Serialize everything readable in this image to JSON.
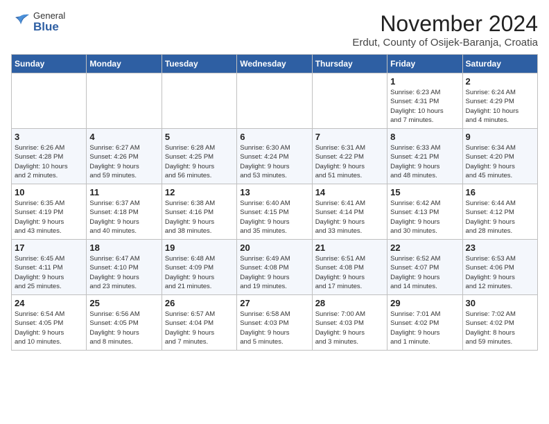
{
  "header": {
    "logo_general": "General",
    "logo_blue": "Blue",
    "main_title": "November 2024",
    "subtitle": "Erdut, County of Osijek-Baranja, Croatia"
  },
  "calendar": {
    "weekdays": [
      "Sunday",
      "Monday",
      "Tuesday",
      "Wednesday",
      "Thursday",
      "Friday",
      "Saturday"
    ],
    "weeks": [
      [
        {
          "day": "",
          "info": ""
        },
        {
          "day": "",
          "info": ""
        },
        {
          "day": "",
          "info": ""
        },
        {
          "day": "",
          "info": ""
        },
        {
          "day": "",
          "info": ""
        },
        {
          "day": "1",
          "info": "Sunrise: 6:23 AM\nSunset: 4:31 PM\nDaylight: 10 hours\nand 7 minutes."
        },
        {
          "day": "2",
          "info": "Sunrise: 6:24 AM\nSunset: 4:29 PM\nDaylight: 10 hours\nand 4 minutes."
        }
      ],
      [
        {
          "day": "3",
          "info": "Sunrise: 6:26 AM\nSunset: 4:28 PM\nDaylight: 10 hours\nand 2 minutes."
        },
        {
          "day": "4",
          "info": "Sunrise: 6:27 AM\nSunset: 4:26 PM\nDaylight: 9 hours\nand 59 minutes."
        },
        {
          "day": "5",
          "info": "Sunrise: 6:28 AM\nSunset: 4:25 PM\nDaylight: 9 hours\nand 56 minutes."
        },
        {
          "day": "6",
          "info": "Sunrise: 6:30 AM\nSunset: 4:24 PM\nDaylight: 9 hours\nand 53 minutes."
        },
        {
          "day": "7",
          "info": "Sunrise: 6:31 AM\nSunset: 4:22 PM\nDaylight: 9 hours\nand 51 minutes."
        },
        {
          "day": "8",
          "info": "Sunrise: 6:33 AM\nSunset: 4:21 PM\nDaylight: 9 hours\nand 48 minutes."
        },
        {
          "day": "9",
          "info": "Sunrise: 6:34 AM\nSunset: 4:20 PM\nDaylight: 9 hours\nand 45 minutes."
        }
      ],
      [
        {
          "day": "10",
          "info": "Sunrise: 6:35 AM\nSunset: 4:19 PM\nDaylight: 9 hours\nand 43 minutes."
        },
        {
          "day": "11",
          "info": "Sunrise: 6:37 AM\nSunset: 4:18 PM\nDaylight: 9 hours\nand 40 minutes."
        },
        {
          "day": "12",
          "info": "Sunrise: 6:38 AM\nSunset: 4:16 PM\nDaylight: 9 hours\nand 38 minutes."
        },
        {
          "day": "13",
          "info": "Sunrise: 6:40 AM\nSunset: 4:15 PM\nDaylight: 9 hours\nand 35 minutes."
        },
        {
          "day": "14",
          "info": "Sunrise: 6:41 AM\nSunset: 4:14 PM\nDaylight: 9 hours\nand 33 minutes."
        },
        {
          "day": "15",
          "info": "Sunrise: 6:42 AM\nSunset: 4:13 PM\nDaylight: 9 hours\nand 30 minutes."
        },
        {
          "day": "16",
          "info": "Sunrise: 6:44 AM\nSunset: 4:12 PM\nDaylight: 9 hours\nand 28 minutes."
        }
      ],
      [
        {
          "day": "17",
          "info": "Sunrise: 6:45 AM\nSunset: 4:11 PM\nDaylight: 9 hours\nand 25 minutes."
        },
        {
          "day": "18",
          "info": "Sunrise: 6:47 AM\nSunset: 4:10 PM\nDaylight: 9 hours\nand 23 minutes."
        },
        {
          "day": "19",
          "info": "Sunrise: 6:48 AM\nSunset: 4:09 PM\nDaylight: 9 hours\nand 21 minutes."
        },
        {
          "day": "20",
          "info": "Sunrise: 6:49 AM\nSunset: 4:08 PM\nDaylight: 9 hours\nand 19 minutes."
        },
        {
          "day": "21",
          "info": "Sunrise: 6:51 AM\nSunset: 4:08 PM\nDaylight: 9 hours\nand 17 minutes."
        },
        {
          "day": "22",
          "info": "Sunrise: 6:52 AM\nSunset: 4:07 PM\nDaylight: 9 hours\nand 14 minutes."
        },
        {
          "day": "23",
          "info": "Sunrise: 6:53 AM\nSunset: 4:06 PM\nDaylight: 9 hours\nand 12 minutes."
        }
      ],
      [
        {
          "day": "24",
          "info": "Sunrise: 6:54 AM\nSunset: 4:05 PM\nDaylight: 9 hours\nand 10 minutes."
        },
        {
          "day": "25",
          "info": "Sunrise: 6:56 AM\nSunset: 4:05 PM\nDaylight: 9 hours\nand 8 minutes."
        },
        {
          "day": "26",
          "info": "Sunrise: 6:57 AM\nSunset: 4:04 PM\nDaylight: 9 hours\nand 7 minutes."
        },
        {
          "day": "27",
          "info": "Sunrise: 6:58 AM\nSunset: 4:03 PM\nDaylight: 9 hours\nand 5 minutes."
        },
        {
          "day": "28",
          "info": "Sunrise: 7:00 AM\nSunset: 4:03 PM\nDaylight: 9 hours\nand 3 minutes."
        },
        {
          "day": "29",
          "info": "Sunrise: 7:01 AM\nSunset: 4:02 PM\nDaylight: 9 hours\nand 1 minute."
        },
        {
          "day": "30",
          "info": "Sunrise: 7:02 AM\nSunset: 4:02 PM\nDaylight: 8 hours\nand 59 minutes."
        }
      ]
    ]
  }
}
